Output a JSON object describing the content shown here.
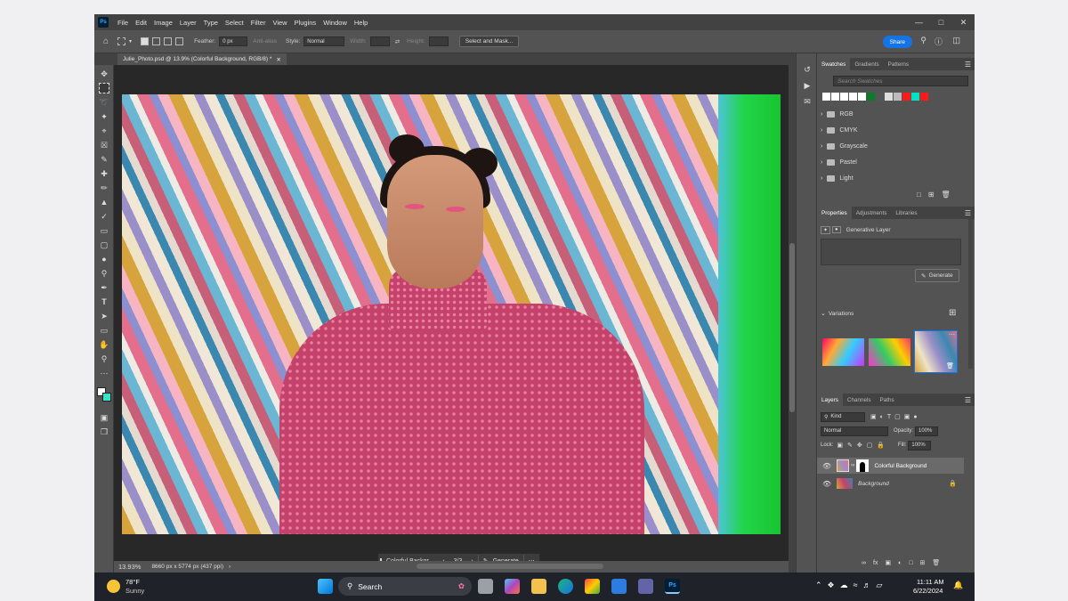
{
  "menubar": {
    "app_icon": "Ps",
    "items": [
      "File",
      "Edit",
      "Image",
      "Layer",
      "Type",
      "Select",
      "Filter",
      "View",
      "Plugins",
      "Window",
      "Help"
    ]
  },
  "options": {
    "feather_label": "Feather:",
    "feather_value": "0 px",
    "antialias_label": "Anti-alias",
    "style_label": "Style:",
    "style_value": "Normal",
    "width_label": "Width:",
    "height_label": "Height:",
    "select_mask_label": "Select and Mask...",
    "share_label": "Share"
  },
  "document": {
    "tab_title": "Julie_Photo.psd @ 13.9% (Colorful Background, RGB/8) *",
    "zoom": "13.93%",
    "dimensions": "8660 px x 5774 px (437 ppi)"
  },
  "genbar": {
    "layer_name": "Colorful Backgr...",
    "counter": "3/3",
    "generate_label": "Generate"
  },
  "swatches": {
    "tabs": [
      "Swatches",
      "Gradients",
      "Patterns"
    ],
    "search_placeholder": "Search Swatches",
    "colors": [
      "#ffffff",
      "#ffffff",
      "#ffffff",
      "#ffffff",
      "#ffffff",
      "#0b7a2b",
      "#555555",
      "#dddddd",
      "#bbbbbb",
      "#ff1a1a",
      "#00e0c6",
      "#ff1a1a"
    ],
    "groups": [
      "RGB",
      "CMYK",
      "Grayscale",
      "Pastel",
      "Light"
    ]
  },
  "properties": {
    "tabs": [
      "Properties",
      "Adjustments",
      "Libraries"
    ],
    "layer_type": "Generative Layer",
    "generate_label": "Generate",
    "variations_label": "Variations"
  },
  "layers": {
    "tabs": [
      "Layers",
      "Channels",
      "Paths"
    ],
    "kind_label": "Kind",
    "blend_mode": "Normal",
    "opacity_label": "Opacity:",
    "opacity_value": "100%",
    "lock_label": "Lock:",
    "fill_label": "Fill:",
    "fill_value": "100%",
    "items": [
      "Colorful Background",
      "Background"
    ]
  },
  "taskbar": {
    "temperature": "78°F",
    "weather": "Sunny",
    "search_label": "Search",
    "time": "11:11 AM",
    "date": "6/22/2024"
  }
}
